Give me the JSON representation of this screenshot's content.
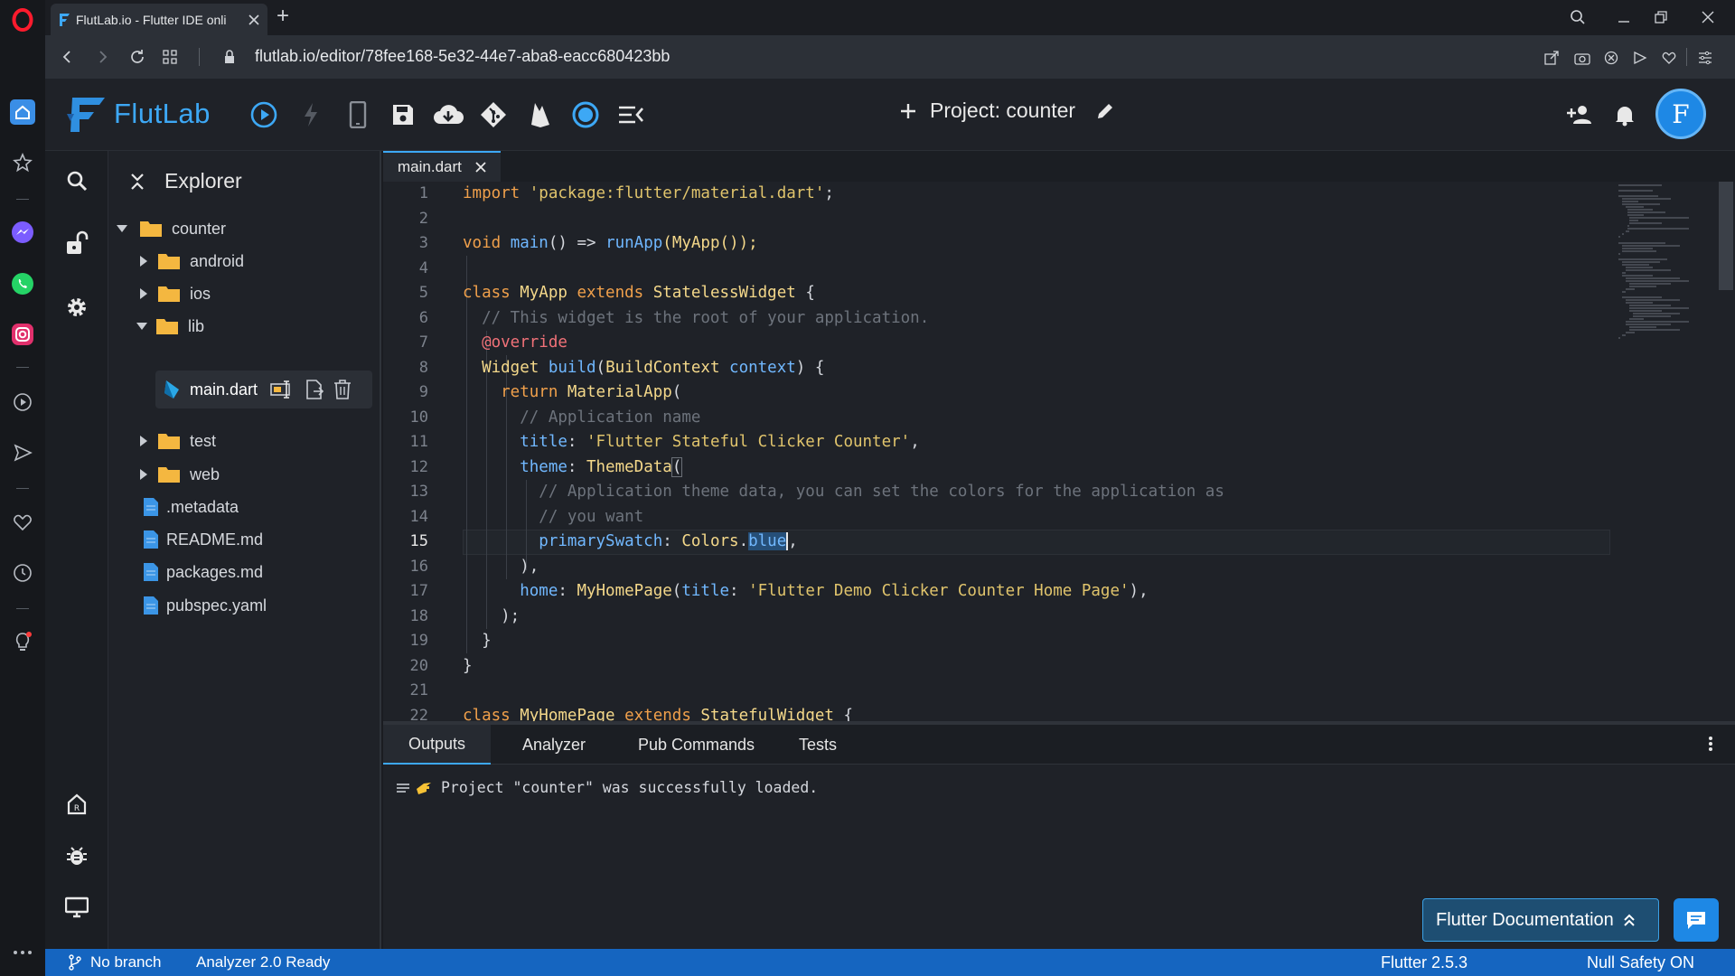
{
  "browser": {
    "tab_title": "FlutLab.io - Flutter IDE onli",
    "url": "flutlab.io/editor/78fee168-5e32-44e7-aba8-eacc680423bb",
    "new_tab": "+"
  },
  "app": {
    "logo_text": "FlutLab",
    "project_label": "Project: counter",
    "avatar_letter": "F",
    "accent": "#3da8f5"
  },
  "explorer": {
    "title": "Explorer",
    "tree": [
      {
        "label": "counter",
        "type": "folder",
        "expanded": true
      },
      {
        "label": "android",
        "type": "folder",
        "expanded": false
      },
      {
        "label": "ios",
        "type": "folder",
        "expanded": false
      },
      {
        "label": "lib",
        "type": "folder",
        "expanded": true
      },
      {
        "label": "main.dart",
        "type": "dart-file",
        "selected": true
      },
      {
        "label": "test",
        "type": "folder",
        "expanded": false
      },
      {
        "label": "web",
        "type": "folder",
        "expanded": false
      },
      {
        "label": ".metadata",
        "type": "file"
      },
      {
        "label": "README.md",
        "type": "file"
      },
      {
        "label": "packages.md",
        "type": "file"
      },
      {
        "label": "pubspec.yaml",
        "type": "file"
      }
    ]
  },
  "editor": {
    "tab_name": "main.dart",
    "current_line": "15",
    "line_numbers": [
      "1",
      "2",
      "3",
      "4",
      "5",
      "6",
      "7",
      "8",
      "9",
      "10",
      "11",
      "12",
      "13",
      "14",
      "15",
      "16",
      "17",
      "18",
      "19",
      "20",
      "21",
      "22"
    ],
    "code": {
      "l1_kw": "import",
      "l1_str": " 'package:flutter/material.dart'",
      "l1_end": ";",
      "l3_kw": "void",
      "l3_fn": " main",
      "l3_mid": "() => ",
      "l3_fn2": "runApp",
      "l3_rest": "(MyApp());",
      "l5_kw": "class",
      "l5_cls": " MyApp",
      "l5_kw2": " extends",
      "l5_cls2": " StatelessWidget",
      "l5_end": " {",
      "l6": "  // This widget is the root of your application.",
      "l7": "  @override",
      "l8_cls": "  Widget",
      "l8_fn": " build",
      "l8_a": "(",
      "l8_cls2": "BuildContext",
      "l8_p": " context",
      "l8_end": ") {",
      "l9_kw": "    return",
      "l9_cls": " MaterialApp",
      "l9_end": "(",
      "l10": "      // Application name",
      "l11_p": "      title",
      "l11_c": ": ",
      "l11_str": "'Flutter Stateful Clicker Counter'",
      "l11_end": ",",
      "l12_p": "      theme",
      "l12_c": ": ",
      "l12_cls": "ThemeData",
      "l12_end": "(",
      "l13": "        // Application theme data, you can set the colors for the application as",
      "l14": "        // you want",
      "l15_p": "        primarySwatch",
      "l15_c": ": ",
      "l15_cls": "Colors",
      "l15_dot": ".",
      "l15_hl": "blue",
      "l15_end": ",",
      "l16": "      ),",
      "l17_p": "      home",
      "l17_c": ": ",
      "l17_cls": "MyHomePage",
      "l17_a": "(",
      "l17_p2": "title",
      "l17_c2": ": ",
      "l17_str": "'Flutter Demo Clicker Counter Home Page'",
      "l17_end": "),",
      "l18": "    );",
      "l19": "  }",
      "l20": "}",
      "l22_kw": "class",
      "l22_cls": " MyHomePage",
      "l22_kw2": " extends",
      "l22_cls2": " StatefulWidget",
      "l22_end": " {"
    }
  },
  "bottom_panel": {
    "tabs": [
      "Outputs",
      "Analyzer",
      "Pub Commands",
      "Tests"
    ],
    "active_tab": "Outputs",
    "output_message": "Project \"counter\" was successfully loaded.",
    "doc_button": "Flutter Documentation"
  },
  "status_bar": {
    "branch": "No branch",
    "analyzer": "Analyzer 2.0 Ready",
    "flutter_version": "Flutter 2.5.3",
    "null_safety": "Null Safety ON"
  }
}
